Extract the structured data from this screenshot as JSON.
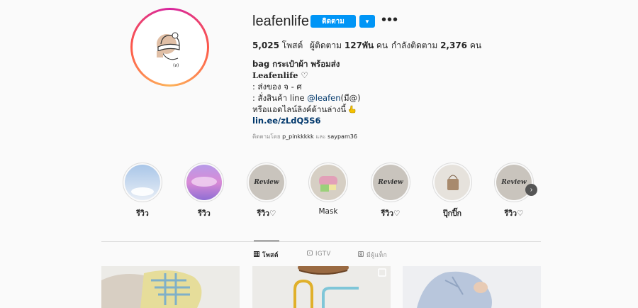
{
  "profile": {
    "username": "leafenlife",
    "follow_label": "ติดตาม",
    "dropdown_icon": "chevron-down-icon",
    "more_icon": "more-horizontal-icon"
  },
  "stats": {
    "posts_count": "5,025",
    "posts_label": "โพสต์",
    "followers_prefix": "ผู้ติดตาม",
    "followers_count": "127พัน",
    "followers_suffix": "คน",
    "following_prefix": "กำลังติดตาม",
    "following_count": "2,376",
    "following_suffix": "คน"
  },
  "bio": {
    "line1_prefix": "bag",
    "line1_rest": "กระเป๋าผ้า พร้อมส่ง",
    "name": "Leafenlife",
    "name_heart": "♡",
    "line3": ": ส่งของ จ - ศ",
    "line4_prefix": ": สั่งสินค้า line",
    "line4_handle": "@leafen",
    "line4_suffix": "(มี@)",
    "line5": "หรือแอดไลน์ลิงค์ด้านล่างนี้",
    "line5_icon": "pointing-hand-icon",
    "link": "lin.ee/zLdQ5S6"
  },
  "followed_by": {
    "prefix": "ติดตามโดย",
    "user1": "p_pinkkkkk",
    "and": "และ",
    "user2": "saypam36"
  },
  "highlights": [
    {
      "label": "รีวิว",
      "cover": "sky"
    },
    {
      "label": "รีวิว",
      "cover": "purple-sky"
    },
    {
      "label": "รีวิว♡",
      "cover": "Review"
    },
    {
      "label": "Mask",
      "cover": "mask"
    },
    {
      "label": "รีวิว♡",
      "cover": "Review"
    },
    {
      "label": "ปุ๊กปิ๊ก",
      "cover": "bag"
    },
    {
      "label": "รีวิว♡",
      "cover": "Review"
    }
  ],
  "tabs": [
    {
      "label": "โพสต์",
      "icon": "grid-icon"
    },
    {
      "label": "IGTV",
      "icon": "igtv-icon"
    },
    {
      "label": "มีผู้แท็ก",
      "icon": "tagged-icon"
    }
  ],
  "colors": {
    "accent": "#0095f6",
    "link": "#00376b",
    "muted": "#8e8e8e"
  }
}
